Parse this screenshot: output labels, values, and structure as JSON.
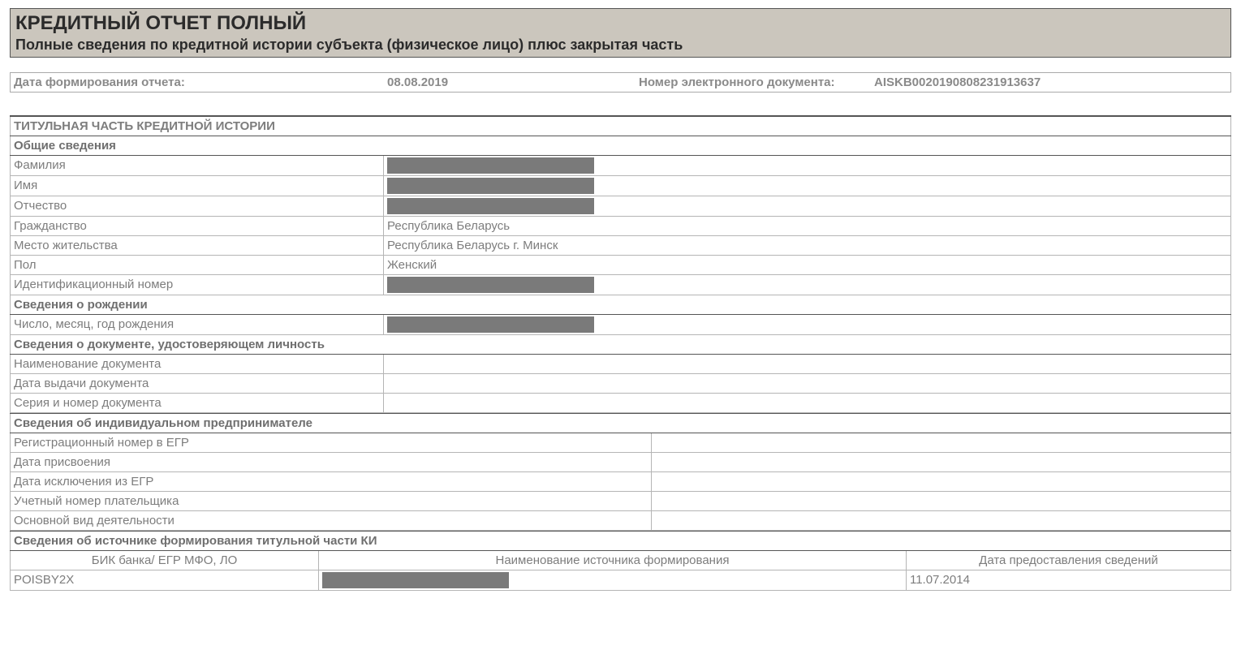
{
  "header": {
    "title": "КРЕДИТНЫЙ ОТЧЕТ ПОЛНЫЙ",
    "subtitle": "Полные сведения по кредитной истории субъекта (физическое лицо) плюс закрытая часть"
  },
  "meta": {
    "date_label": "Дата формирования отчета:",
    "date_value": "08.08.2019",
    "docnum_label": "Номер электронного документа:",
    "docnum_value": "AISKB0020190808231913637"
  },
  "sections": {
    "title_section": "ТИТУЛЬНАЯ ЧАСТЬ КРЕДИТНОЙ ИСТОРИИ",
    "general_sub": "Общие сведения",
    "surname_lbl": "Фамилия",
    "firstname_lbl": "Имя",
    "patronymic_lbl": "Отчество",
    "citizenship_lbl": "Гражданство",
    "citizenship_val": "Республика Беларусь",
    "residence_lbl": "Место жительства",
    "residence_val": "Республика Беларусь г. Минск",
    "sex_lbl": "Пол",
    "sex_val": "Женский",
    "idnum_lbl": "Идентификационный номер",
    "birth_sub": "Сведения о рождении",
    "dob_lbl": "Число, месяц, год рождения",
    "iddoc_sub": "Сведения о документе, удостоверяющем личность",
    "docname_lbl": "Наименование документа",
    "docissue_lbl": "Дата выдачи документа",
    "docseries_lbl": "Серия и номер документа",
    "ip_sub": "Сведения об индивидуальном предпринимателе",
    "regnum_lbl": "Регистрационный номер в ЕГР",
    "assigndate_lbl": "Дата присвоения",
    "exclusiondate_lbl": "Дата исключения из ЕГР",
    "taxnum_lbl": "Учетный номер плательщика",
    "mainact_lbl": "Основной вид деятельности",
    "source_sub": "Сведения об источнике формирования титульной части КИ",
    "src_col1": "БИК банка/ ЕГР МФО, ЛО",
    "src_col2": "Наименование источника формирования",
    "src_col3": "Дата предоставления сведений",
    "src_row_bic": "POISBY2X",
    "src_row_date": "11.07.2014"
  }
}
